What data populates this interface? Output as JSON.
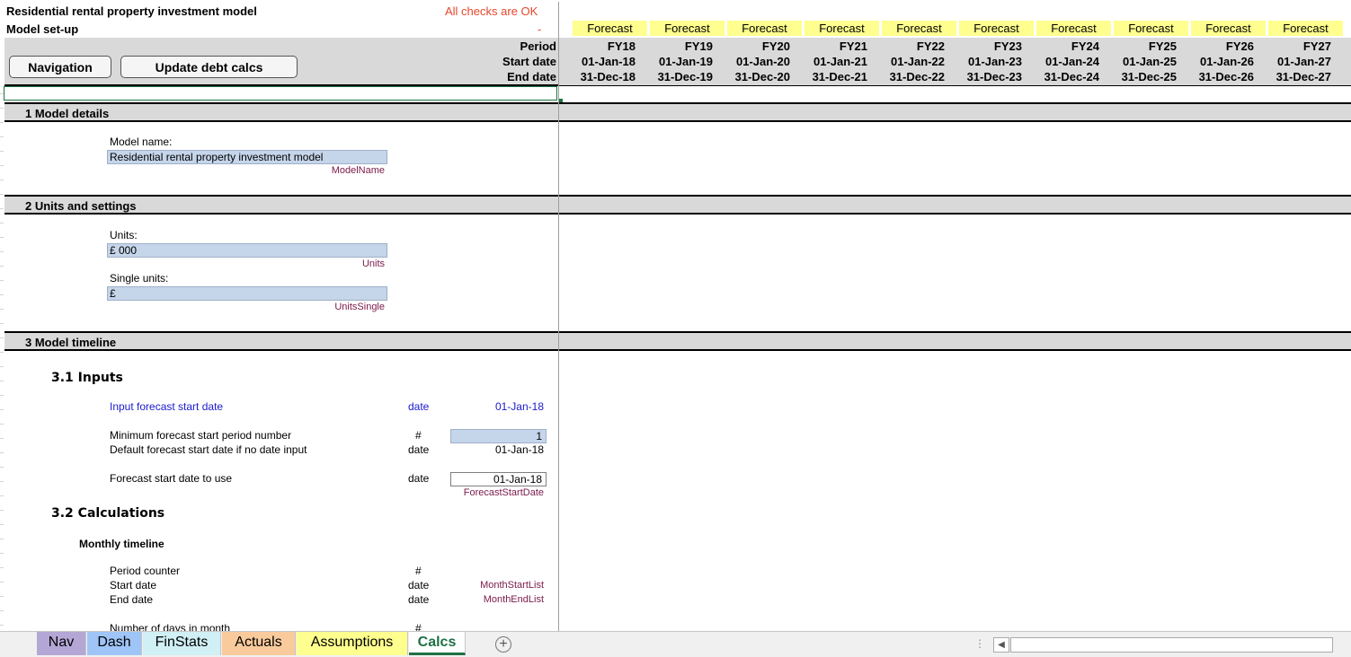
{
  "header": {
    "title": "Residential rental property investment model",
    "sheet_subtitle": "Model set-up",
    "checks_status": "All checks are OK",
    "checks_dash": "-",
    "period_label": "Period",
    "start_label": "Start date",
    "end_label": "End date",
    "navigation_button": "Navigation",
    "update_button": "Update debt calcs",
    "columns": [
      {
        "type": "Forecast",
        "period": "FY18",
        "start": "01-Jan-18",
        "end": "31-Dec-18"
      },
      {
        "type": "Forecast",
        "period": "FY19",
        "start": "01-Jan-19",
        "end": "31-Dec-19"
      },
      {
        "type": "Forecast",
        "period": "FY20",
        "start": "01-Jan-20",
        "end": "31-Dec-20"
      },
      {
        "type": "Forecast",
        "period": "FY21",
        "start": "01-Jan-21",
        "end": "31-Dec-21"
      },
      {
        "type": "Forecast",
        "period": "FY22",
        "start": "01-Jan-22",
        "end": "31-Dec-22"
      },
      {
        "type": "Forecast",
        "period": "FY23",
        "start": "01-Jan-23",
        "end": "31-Dec-23"
      },
      {
        "type": "Forecast",
        "period": "FY24",
        "start": "01-Jan-24",
        "end": "31-Dec-24"
      },
      {
        "type": "Forecast",
        "period": "FY25",
        "start": "01-Jan-25",
        "end": "31-Dec-25"
      },
      {
        "type": "Forecast",
        "period": "FY26",
        "start": "01-Jan-26",
        "end": "31-Dec-26"
      },
      {
        "type": "Forecast",
        "period": "FY27",
        "start": "01-Jan-27",
        "end": "31-Dec-27"
      }
    ]
  },
  "sections": {
    "s1": "1 Model details",
    "s2": "2 Units and settings",
    "s3": "3 Model timeline"
  },
  "model_details": {
    "name_label": "Model name:",
    "name_value": "Residential rental property investment model",
    "name_range": "ModelName"
  },
  "units": {
    "units_label": "Units:",
    "units_value": "£ 000",
    "units_range": "Units",
    "single_label": "Single units:",
    "single_value": "£",
    "single_range": "UnitsSingle"
  },
  "timeline": {
    "inputs_heading": "3.1 Inputs",
    "input_start_label": "Input forecast start date",
    "input_start_unit": "date",
    "input_start_value": "01-Jan-18",
    "min_period_label": "Minimum forecast start period number",
    "min_period_unit": "#",
    "min_period_value": "1",
    "default_start_label": "Default forecast start date if no date input",
    "default_start_unit": "date",
    "default_start_value": "01-Jan-18",
    "use_start_label": "Forecast start date to use",
    "use_start_unit": "date",
    "use_start_value": "01-Jan-18",
    "use_start_range": "ForecastStartDate",
    "calcs_heading": "3.2 Calculations",
    "monthly_heading": "Monthly timeline",
    "counter_label": "Period counter",
    "counter_unit": "#",
    "mstart_label": "Start date",
    "mstart_unit": "date",
    "mstart_range": "MonthStartList",
    "mend_label": "End date",
    "mend_unit": "date",
    "mend_range": "MonthEndList",
    "days_label": "Number of days in month",
    "days_unit": "#"
  },
  "tabs": [
    {
      "label": "Nav",
      "color": "#b4a7d6"
    },
    {
      "label": "Dash",
      "color": "#9fc5f8"
    },
    {
      "label": "FinStats",
      "color": "#d0f0f5"
    },
    {
      "label": "Actuals",
      "color": "#f9cb9c"
    },
    {
      "label": "Assumptions",
      "color": "#ffff8f"
    },
    {
      "label": "Calcs",
      "color": "#ffffff"
    }
  ],
  "add_sheet": "+"
}
